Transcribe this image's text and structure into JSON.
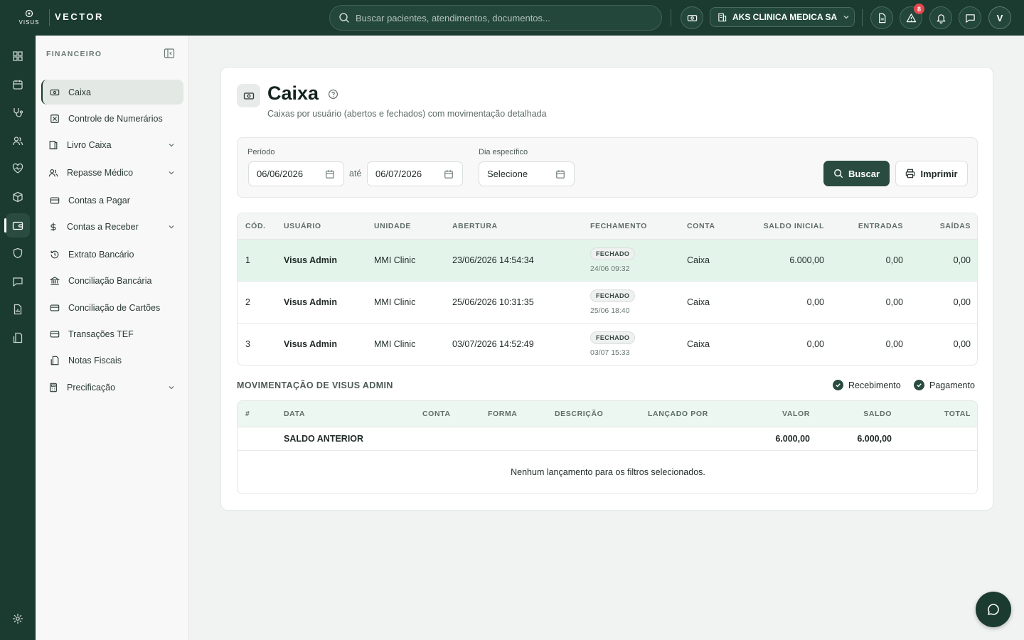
{
  "brand": {
    "logo_text": "VISUS",
    "name": "VECTOR"
  },
  "topbar": {
    "search_placeholder": "Buscar pacientes, atendimentos, documentos...",
    "company": "AKS CLINICA MEDICA SA",
    "alerts_count": "8",
    "avatar_initial": "V"
  },
  "sidebar": {
    "title": "FINANCEIRO",
    "items": [
      {
        "label": "Caixa",
        "icon": "cash-icon",
        "active": true
      },
      {
        "label": "Controle de Numerários",
        "icon": "x-square-icon"
      },
      {
        "label": "Livro Caixa",
        "icon": "book-icon",
        "expandable": true
      },
      {
        "label": "Repasse Médico",
        "icon": "users-icon",
        "expandable": true
      },
      {
        "label": "Contas a Pagar",
        "icon": "card-icon"
      },
      {
        "label": "Contas a Receber",
        "icon": "dollar-icon",
        "expandable": true
      },
      {
        "label": "Extrato Bancário",
        "icon": "history-icon"
      },
      {
        "label": "Conciliação Bancária",
        "icon": "bank-icon"
      },
      {
        "label": "Conciliação de Cartões",
        "icon": "card-icon"
      },
      {
        "label": "Transações TEF",
        "icon": "card-icon"
      },
      {
        "label": "Notas Fiscais",
        "icon": "invoice-icon"
      },
      {
        "label": "Precificação",
        "icon": "calculator-icon",
        "expandable": true
      }
    ]
  },
  "page": {
    "title": "Caixa",
    "subtitle": "Caixas por usuário (abertos e fechados) com movimentação detalhada"
  },
  "filters": {
    "period_label": "Período",
    "date_from": "06/06/2026",
    "between": "até",
    "date_to": "06/07/2026",
    "day_label": "Dia específico",
    "day_value": "Selecione",
    "search_button": "Buscar",
    "print_button": "Imprimir"
  },
  "cash_table": {
    "columns": [
      "CÓD.",
      "USUÁRIO",
      "UNIDADE",
      "ABERTURA",
      "FECHAMENTO",
      "CONTA",
      "SALDO INICIAL",
      "ENTRADAS",
      "SAÍDAS"
    ],
    "rows": [
      {
        "code": "1",
        "user": "Visus Admin",
        "unit": "MMI Clinic",
        "opened": "23/06/2026 14:54:34",
        "status": "FECHADO",
        "closed": "24/06 09:32",
        "account": "Caixa",
        "initial": "6.000,00",
        "in": "0,00",
        "out": "0,00"
      },
      {
        "code": "2",
        "user": "Visus Admin",
        "unit": "MMI Clinic",
        "opened": "25/06/2026 10:31:35",
        "status": "FECHADO",
        "closed": "25/06 18:40",
        "account": "Caixa",
        "initial": "0,00",
        "in": "0,00",
        "out": "0,00"
      },
      {
        "code": "3",
        "user": "Visus Admin",
        "unit": "MMI Clinic",
        "opened": "03/07/2026 14:52:49",
        "status": "FECHADO",
        "closed": "03/07 15:33",
        "account": "Caixa",
        "initial": "0,00",
        "in": "0,00",
        "out": "0,00"
      }
    ]
  },
  "movement": {
    "title": "MOVIMENTAÇÃO DE VISUS ADMIN",
    "filter_receipt": "Recebimento",
    "filter_payment": "Pagamento",
    "columns": [
      "#",
      "DATA",
      "CONTA",
      "FORMA",
      "DESCRIÇÃO",
      "LANÇADO POR",
      "VALOR",
      "SALDO",
      "TOTAL"
    ],
    "previous_balance_label": "SALDO ANTERIOR",
    "previous_value": "6.000,00",
    "previous_balance": "6.000,00",
    "empty_message": "Nenhum lançamento para os filtros selecionados."
  },
  "colors": {
    "primary": "#1b3a30",
    "button": "#2a4c40",
    "highlight_row": "#e3f5ea",
    "badge": "#e5484d"
  }
}
